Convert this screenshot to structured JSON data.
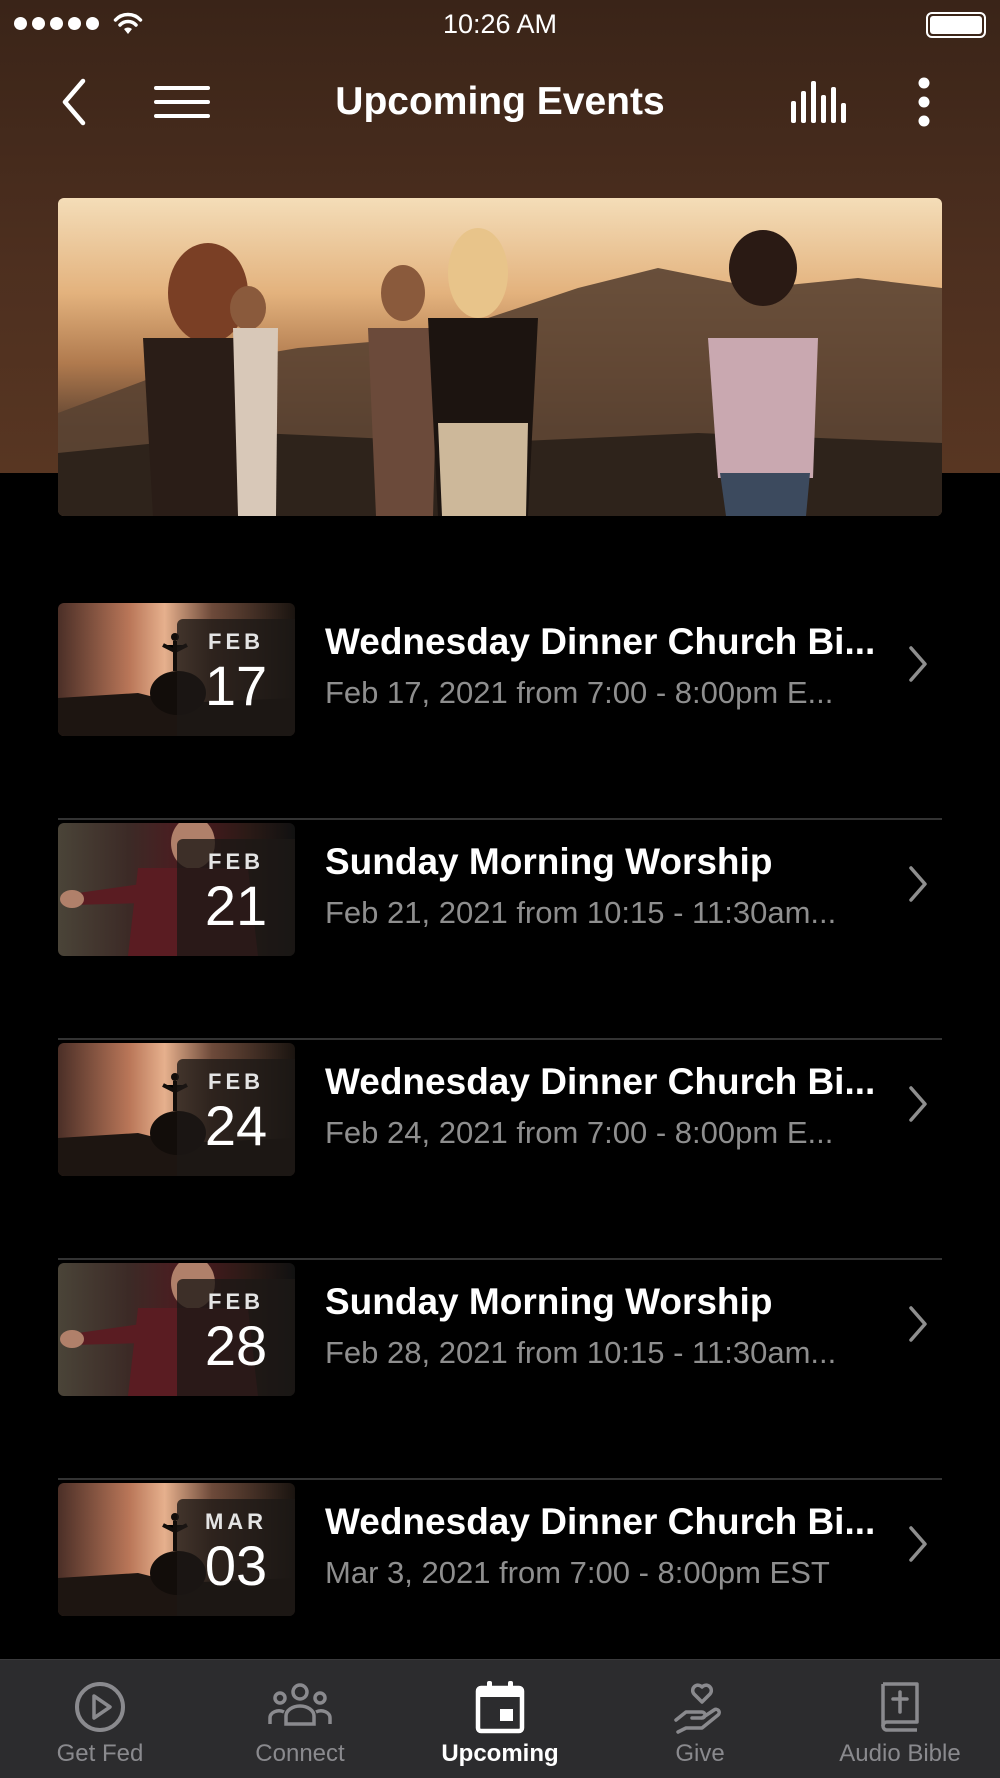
{
  "status_bar": {
    "time": "10:26 AM"
  },
  "nav": {
    "title": "Upcoming Events"
  },
  "events": [
    {
      "month": "FEB",
      "day": "17",
      "title": "Wednesday Dinner Church Bi...",
      "subtitle": "Feb 17, 2021 from 7:00 - 8:00pm E..."
    },
    {
      "month": "FEB",
      "day": "21",
      "title": "Sunday Morning Worship",
      "subtitle": "Feb 21, 2021 from 10:15 - 11:30am..."
    },
    {
      "month": "FEB",
      "day": "24",
      "title": "Wednesday Dinner Church Bi...",
      "subtitle": "Feb 24, 2021 from 7:00 - 8:00pm E..."
    },
    {
      "month": "FEB",
      "day": "28",
      "title": "Sunday Morning Worship",
      "subtitle": "Feb 28, 2021 from 10:15 - 11:30am..."
    },
    {
      "month": "MAR",
      "day": "03",
      "title": "Wednesday Dinner Church Bi...",
      "subtitle": "Mar 3, 2021 from 7:00 - 8:00pm EST"
    }
  ],
  "tabs": [
    {
      "label": "Get Fed",
      "icon": "play-circle-icon"
    },
    {
      "label": "Connect",
      "icon": "people-icon"
    },
    {
      "label": "Upcoming",
      "icon": "calendar-icon",
      "active": true
    },
    {
      "label": "Give",
      "icon": "hand-heart-icon"
    },
    {
      "label": "Audio Bible",
      "icon": "bible-icon"
    }
  ],
  "colors": {
    "header_brown": "#4d2f1f",
    "background": "#000000",
    "tabbar": "#2c2c2e",
    "muted_text": "#8e8e8e"
  }
}
